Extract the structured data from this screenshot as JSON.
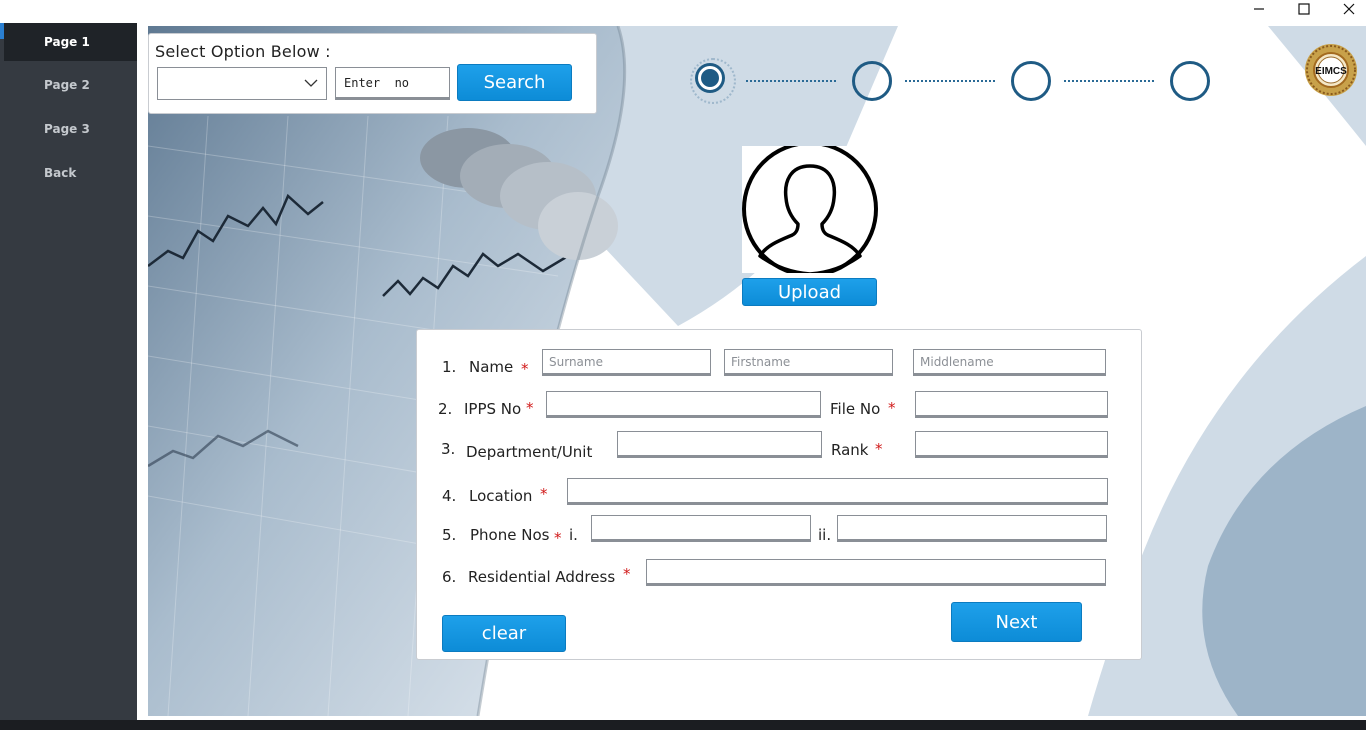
{
  "window": {
    "controls": {
      "minimize": "—",
      "maximize": "☐",
      "close": "✕"
    }
  },
  "sidebar": {
    "items": [
      {
        "label": "Page 1",
        "active": true
      },
      {
        "label": "Page 2",
        "active": false
      },
      {
        "label": "Page 3",
        "active": false
      },
      {
        "label": "Back",
        "active": false
      }
    ]
  },
  "search": {
    "label": "Select  Option Below :",
    "select_value": "",
    "input_value": "Enter  no",
    "button_label": "Search"
  },
  "stepper": {
    "current_step": 1,
    "total_steps": 4
  },
  "logo": {
    "text": "EIMCS"
  },
  "photo": {
    "upload_label": "Upload"
  },
  "form": {
    "name": {
      "number": "1.",
      "label": "Name",
      "surname_placeholder": "Surname",
      "firstname_placeholder": "Firstname",
      "middlename_placeholder": "Middlename"
    },
    "ipps": {
      "number": "2.",
      "label": "IPPS No",
      "file_label": "File No"
    },
    "department": {
      "number": "3.",
      "label": "Department/Unit",
      "rank_label": "Rank"
    },
    "location": {
      "number": "4.",
      "label": "Location"
    },
    "phone": {
      "number": "5.",
      "label": "Phone Nos",
      "first_marker": "i.",
      "second_marker": "ii."
    },
    "address": {
      "number": "6.",
      "label": "Residential Address"
    },
    "required_marker": "*",
    "clear_label": "clear",
    "next_label": "Next"
  },
  "colors": {
    "sidebar_bg": "#353a41",
    "sidebar_active": "#1f2328",
    "accent_blue": "#1ea0ea",
    "step_blue": "#1f5b84",
    "required_red": "#d11b1b",
    "shape_light": "#cdd9e4",
    "shape_dark": "#9db4c8"
  }
}
